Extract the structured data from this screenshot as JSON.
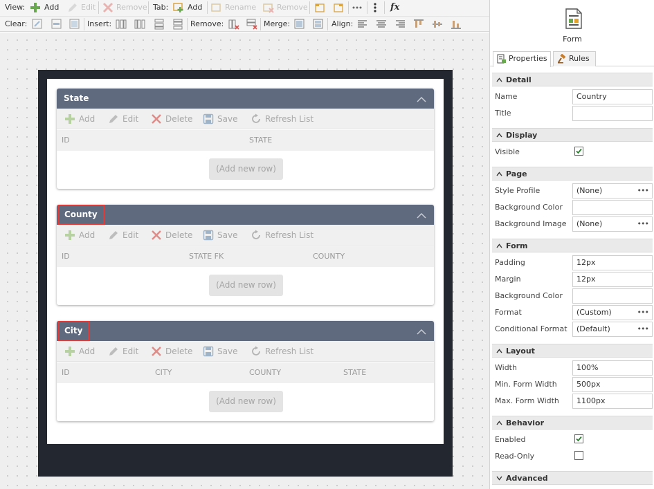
{
  "toolbar": {
    "view_label": "View:",
    "view_add": "Add",
    "view_edit": "Edit",
    "view_remove": "Remove",
    "tab_label": "Tab:",
    "tab_add": "Add",
    "tab_rename": "Rename",
    "tab_remove": "Remove",
    "clear_label": "Clear:",
    "insert_label": "Insert:",
    "remove_label": "Remove:",
    "merge_label": "Merge:",
    "align_label": "Align:",
    "fx": "fx"
  },
  "panels": [
    {
      "title": "State",
      "highlighted": false,
      "columns": [
        "ID",
        "STATE"
      ],
      "add_row": "(Add new row)"
    },
    {
      "title": "County",
      "highlighted": true,
      "columns": [
        "ID",
        "STATE FK",
        "COUNTY"
      ],
      "add_row": "(Add new row)"
    },
    {
      "title": "City",
      "highlighted": true,
      "columns": [
        "ID",
        "CITY",
        "COUNTY",
        "STATE"
      ],
      "add_row": "(Add new row)"
    }
  ],
  "panel_actions": {
    "add": "Add",
    "edit": "Edit",
    "delete": "Delete",
    "save": "Save",
    "refresh": "Refresh List"
  },
  "side": {
    "caption": "Form",
    "tabs": [
      "Properties",
      "Rules"
    ],
    "sections": {
      "detail": "Detail",
      "display": "Display",
      "page": "Page",
      "form": "Form",
      "layout": "Layout",
      "behavior": "Behavior",
      "advanced": "Advanced"
    },
    "props": {
      "name_label": "Name",
      "name_value": "Country",
      "title_label": "Title",
      "title_value": "",
      "visible_label": "Visible",
      "visible_checked": true,
      "style_profile_label": "Style Profile",
      "style_profile_value": "(None)",
      "bg_color_label": "Background Color",
      "bg_color_value": "",
      "bg_image_label": "Background Image",
      "bg_image_value": "(None)",
      "padding_label": "Padding",
      "padding_value": "12px",
      "margin_label": "Margin",
      "margin_value": "12px",
      "form_bg_color_label": "Background Color",
      "form_bg_color_value": "",
      "format_label": "Format",
      "format_value": "(Custom)",
      "cond_format_label": "Conditional Format",
      "cond_format_value": "(Default)",
      "width_label": "Width",
      "width_value": "100%",
      "min_width_label": "Min. Form Width",
      "min_width_value": "500px",
      "max_width_label": "Max. Form Width",
      "max_width_value": "1100px",
      "enabled_label": "Enabled",
      "enabled_checked": true,
      "readonly_label": "Read-Only",
      "readonly_checked": false
    }
  },
  "colors": {
    "panel_header": "#5f6a7e",
    "frame": "#232830",
    "highlight": "#e53935",
    "add_green": "#6aa84f",
    "delete_red": "#d9534f"
  }
}
